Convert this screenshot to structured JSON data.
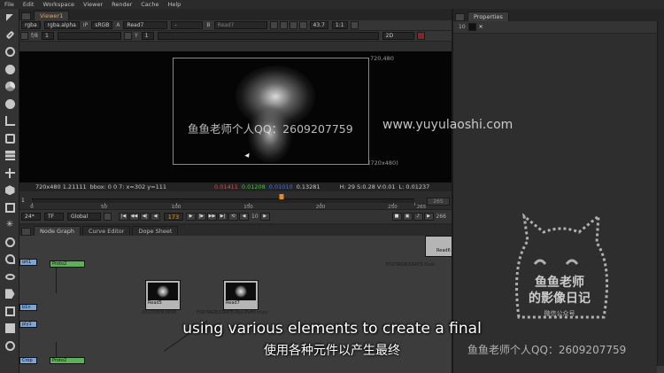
{
  "menubar": [
    "File",
    "Edit",
    "Workspace",
    "Viewer",
    "Render",
    "Cache",
    "Help"
  ],
  "viewer": {
    "tab_label": "Viewer1",
    "channels": "rgba",
    "channel_sel": "rgba.alpha",
    "ip_label": "IP",
    "colorspace": "sRGB",
    "input_a_label": "A",
    "input_a": "Read7",
    "input_a_op": "-",
    "input_b_label": "B",
    "input_b": "Read7",
    "gain_label": "f/8",
    "gain_value": "1",
    "gamma_label": "Y",
    "gamma_value": "1",
    "zoom": "43.7",
    "ratio": "1:1",
    "view_mode": "2D",
    "format_tr": "720,480",
    "format_br": "(720x480)",
    "info": {
      "resolution": "720x480 1.21111",
      "bbox": "bbox: 0 0 7: x=302 y=111",
      "r": "0.01411",
      "g": "0.01208",
      "b": "0.01010",
      "a": "0.13281",
      "hsv": "H: 29 S:0.28 V:0.01",
      "l": "L: 0.01237"
    }
  },
  "timeline": {
    "start": "1",
    "end": "265",
    "ticks": [
      "0",
      "50",
      "100",
      "150",
      "200",
      "250",
      "265"
    ],
    "current_frame": 173,
    "fps": "24*",
    "tf": "TF",
    "scope": "Global",
    "step": "10",
    "end_frame": "266"
  },
  "properties": {
    "tab_label": "Properties",
    "max_panels": "10"
  },
  "node_graph": {
    "tabs": [
      "Node Graph",
      "Curve Editor",
      "Dope Sheet"
    ],
    "nodes": {
      "read5_label": "Read5",
      "read5_file": "20170309.MSM",
      "read7_label": "Read7",
      "read7_file": "FOOTAGE/CRATE-Dus-Puff1.mov",
      "read6_label": "Read6",
      "read6_file": "FOOTAGE/CRATE-Dust",
      "merge_a": "Proto2",
      "merge_b": "Proto2",
      "side_a": "ort1",
      "side_b": "b1n",
      "side_c": "ply1",
      "side_d": "Crop"
    }
  },
  "watermarks": {
    "center": "鱼鱼老师个人QQ：2609207759",
    "url": "www.yuyulaoshi.com",
    "bottom": "鱼鱼老师个人QQ：2609207759",
    "logo_line1": "鱼鱼老师",
    "logo_line2": "的影像日记",
    "logo_line3": "微信公众号"
  },
  "subtitles": {
    "en": "using various elements to create a final",
    "cn": "使用各种元件以产生最终"
  }
}
